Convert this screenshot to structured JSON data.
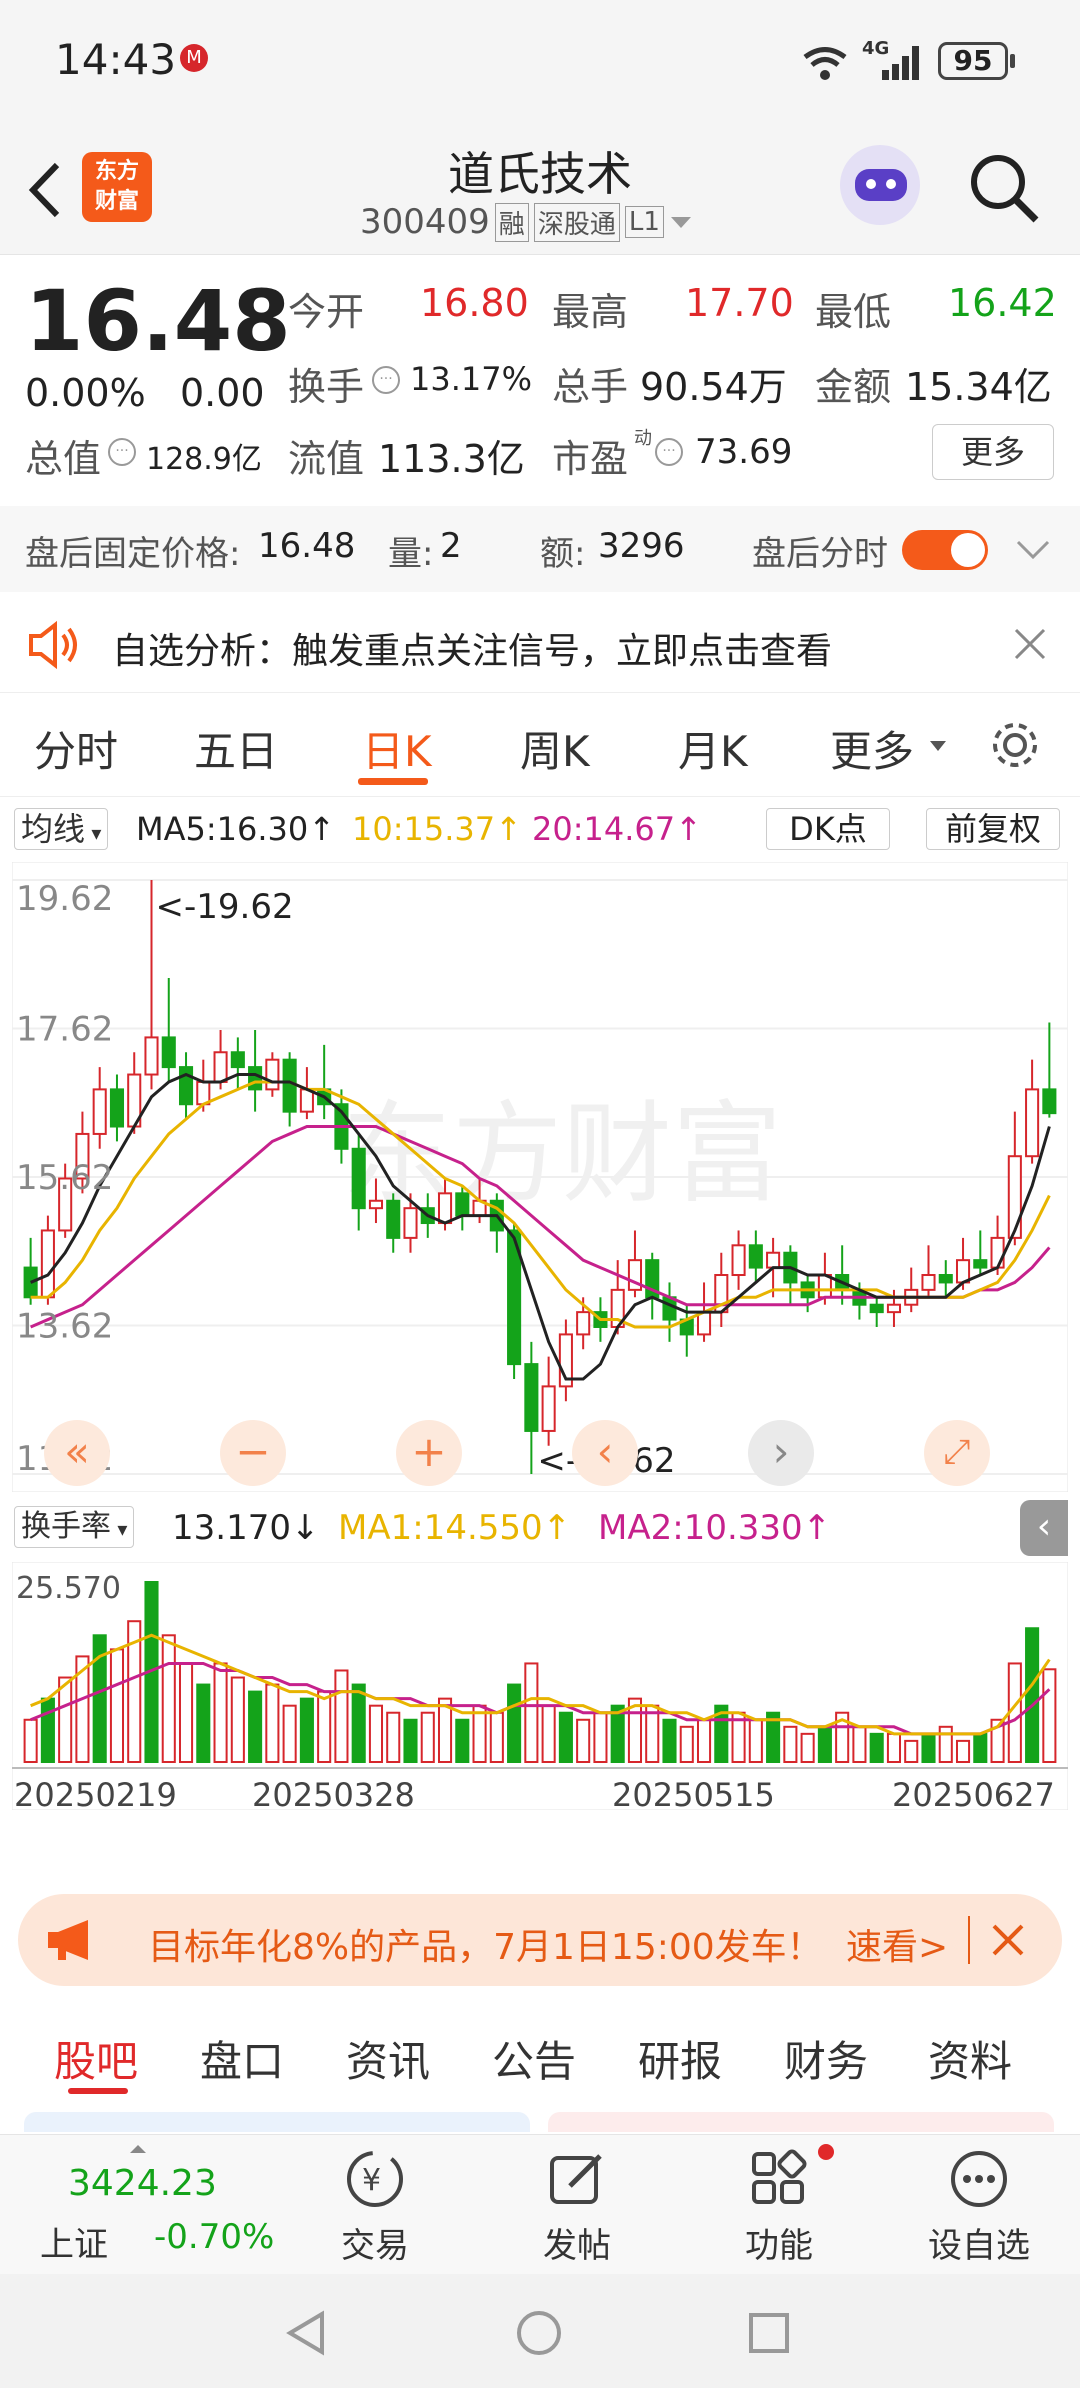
{
  "status": {
    "time": "14:43",
    "network": "4G",
    "battery": "95"
  },
  "header": {
    "back": "<",
    "logo_line1": "东方",
    "logo_line2": "财富",
    "title": "道氏技术",
    "code": "300409",
    "badges": [
      "融",
      "深股通",
      "L1"
    ]
  },
  "quote": {
    "price": "16.48",
    "change_pct": "0.00%",
    "change": "0.00",
    "open_label": "今开",
    "open": "16.80",
    "high_label": "最高",
    "high": "17.70",
    "low_label": "最低",
    "low": "16.42",
    "turnover_label": "换手",
    "turnover": "13.17%",
    "volume_label": "总手",
    "volume": "90.54万",
    "amount_label": "金额",
    "amount": "15.34亿",
    "mktcap_label": "总值",
    "mktcap": "128.9亿",
    "float_label": "流值",
    "float": "113.3亿",
    "pe_label": "市盈",
    "pe_sup": "动",
    "pe": "73.69",
    "more": "更多"
  },
  "afterhours": {
    "price_label": "盘后固定价格:",
    "price": "16.48",
    "vol_label": "量:",
    "vol": "2",
    "amt_label": "额:",
    "amt": "3296",
    "toggle_label": "盘后分时"
  },
  "notice": {
    "text": "自选分析：触发重点关注信号，立即点击查看"
  },
  "tabs": [
    "分时",
    "五日",
    "日K",
    "周K",
    "月K",
    "更多",
    "settings"
  ],
  "ma_bar": {
    "selector": "均线",
    "ma5": "MA5:16.30↑",
    "ma10": "10:15.37↑",
    "ma20": "20:14.67↑",
    "dk": "DK点",
    "adjust": "前复权"
  },
  "chart_data": {
    "type": "candlestick",
    "y_ticks": [
      "19.62",
      "17.62",
      "15.62",
      "13.62",
      "11.62"
    ],
    "max_label": "<-19.62",
    "min_label": "<-11.62",
    "watermark": "东方财富",
    "ylim": [
      11.62,
      19.62
    ],
    "candles": [
      [
        14.4,
        14.0,
        14.8,
        13.9
      ],
      [
        14.0,
        14.9,
        15.1,
        13.9
      ],
      [
        14.9,
        15.6,
        15.8,
        14.8
      ],
      [
        15.6,
        16.2,
        16.5,
        15.4
      ],
      [
        16.2,
        16.8,
        17.1,
        16.0
      ],
      [
        16.8,
        16.3,
        17.0,
        16.1
      ],
      [
        16.3,
        17.0,
        17.3,
        16.2
      ],
      [
        17.0,
        17.5,
        19.62,
        16.8
      ],
      [
        17.5,
        17.1,
        18.3,
        16.9
      ],
      [
        17.1,
        16.6,
        17.3,
        16.4
      ],
      [
        16.6,
        16.9,
        17.2,
        16.5
      ],
      [
        16.9,
        17.3,
        17.6,
        16.8
      ],
      [
        17.3,
        17.1,
        17.5,
        16.8
      ],
      [
        17.1,
        16.8,
        17.6,
        16.5
      ],
      [
        16.8,
        17.2,
        17.3,
        16.7
      ],
      [
        17.2,
        16.5,
        17.3,
        16.3
      ],
      [
        16.5,
        16.8,
        17.1,
        16.4
      ],
      [
        16.8,
        16.6,
        17.4,
        16.4
      ],
      [
        16.6,
        16.0,
        16.8,
        15.8
      ],
      [
        16.0,
        15.2,
        16.2,
        14.9
      ],
      [
        15.2,
        15.3,
        15.6,
        15.0
      ],
      [
        15.3,
        14.8,
        15.4,
        14.6
      ],
      [
        14.8,
        15.2,
        15.4,
        14.6
      ],
      [
        15.2,
        15.0,
        15.4,
        14.8
      ],
      [
        15.0,
        15.4,
        15.6,
        14.9
      ],
      [
        15.4,
        15.1,
        15.5,
        14.9
      ],
      [
        15.1,
        15.3,
        15.6,
        15.0
      ],
      [
        15.3,
        14.9,
        15.4,
        14.6
      ],
      [
        14.9,
        13.1,
        15.0,
        12.9
      ],
      [
        13.1,
        12.2,
        13.4,
        11.62
      ],
      [
        12.2,
        12.8,
        13.2,
        12.0
      ],
      [
        12.8,
        13.5,
        13.7,
        12.6
      ],
      [
        13.5,
        13.8,
        14.0,
        13.3
      ],
      [
        13.8,
        13.6,
        14.0,
        13.4
      ],
      [
        13.6,
        14.1,
        14.5,
        13.5
      ],
      [
        14.1,
        14.5,
        14.9,
        14.0
      ],
      [
        14.5,
        14.0,
        14.6,
        13.7
      ],
      [
        14.0,
        13.7,
        14.2,
        13.4
      ],
      [
        13.7,
        13.5,
        13.9,
        13.2
      ],
      [
        13.5,
        13.8,
        14.2,
        13.4
      ],
      [
        13.8,
        14.3,
        14.6,
        13.6
      ],
      [
        14.3,
        14.7,
        14.9,
        14.1
      ],
      [
        14.7,
        14.4,
        14.9,
        14.2
      ],
      [
        14.4,
        14.6,
        14.8,
        14.0
      ],
      [
        14.6,
        14.2,
        14.7,
        13.9
      ],
      [
        14.2,
        14.0,
        14.3,
        13.8
      ],
      [
        14.0,
        14.3,
        14.6,
        13.9
      ],
      [
        14.3,
        14.1,
        14.7,
        13.9
      ],
      [
        14.1,
        13.9,
        14.2,
        13.7
      ],
      [
        13.9,
        13.8,
        14.0,
        13.6
      ],
      [
        13.8,
        13.9,
        14.1,
        13.6
      ],
      [
        13.9,
        14.1,
        14.4,
        13.8
      ],
      [
        14.1,
        14.3,
        14.7,
        14.0
      ],
      [
        14.3,
        14.2,
        14.5,
        14.0
      ],
      [
        14.2,
        14.5,
        14.8,
        14.1
      ],
      [
        14.5,
        14.4,
        14.9,
        14.3
      ],
      [
        14.4,
        14.8,
        15.1,
        14.3
      ],
      [
        14.8,
        15.9,
        16.5,
        14.7
      ],
      [
        15.9,
        16.8,
        17.2,
        15.8
      ],
      [
        16.8,
        16.48,
        17.7,
        16.42
      ]
    ],
    "ma5": [
      14.2,
      14.3,
      14.6,
      15.0,
      15.5,
      15.9,
      16.3,
      16.7,
      16.9,
      17.0,
      16.9,
      16.9,
      17.0,
      17.0,
      16.9,
      16.9,
      16.8,
      16.7,
      16.5,
      16.2,
      15.9,
      15.5,
      15.3,
      15.1,
      15.0,
      15.1,
      15.1,
      15.1,
      14.8,
      14.1,
      13.4,
      12.9,
      12.9,
      13.1,
      13.6,
      13.9,
      14.0,
      13.9,
      13.8,
      13.8,
      13.8,
      14.0,
      14.2,
      14.4,
      14.4,
      14.3,
      14.3,
      14.2,
      14.1,
      14.0,
      14.0,
      14.0,
      14.0,
      14.0,
      14.2,
      14.3,
      14.4,
      14.9,
      15.5,
      16.3
    ],
    "ma10": [
      14.0,
      14.0,
      14.2,
      14.5,
      14.9,
      15.2,
      15.6,
      15.9,
      16.2,
      16.4,
      16.6,
      16.7,
      16.8,
      16.9,
      16.9,
      16.9,
      16.8,
      16.8,
      16.7,
      16.6,
      16.4,
      16.2,
      16.0,
      15.8,
      15.6,
      15.5,
      15.3,
      15.2,
      15.0,
      14.7,
      14.4,
      14.1,
      13.9,
      13.7,
      13.7,
      13.6,
      13.6,
      13.6,
      13.7,
      13.8,
      13.9,
      14.0,
      14.0,
      14.1,
      14.1,
      14.1,
      14.1,
      14.1,
      14.1,
      14.1,
      14.0,
      14.0,
      14.0,
      14.0,
      14.0,
      14.1,
      14.2,
      14.5,
      14.9,
      15.37
    ],
    "ma20": [
      13.6,
      13.7,
      13.8,
      13.9,
      14.1,
      14.3,
      14.5,
      14.7,
      14.9,
      15.1,
      15.3,
      15.5,
      15.7,
      15.9,
      16.1,
      16.2,
      16.3,
      16.3,
      16.3,
      16.3,
      16.3,
      16.2,
      16.1,
      16.0,
      15.9,
      15.8,
      15.6,
      15.5,
      15.3,
      15.1,
      14.9,
      14.7,
      14.5,
      14.4,
      14.3,
      14.2,
      14.1,
      14.0,
      13.9,
      13.9,
      13.9,
      13.9,
      13.9,
      13.9,
      13.9,
      13.9,
      14.0,
      14.0,
      14.0,
      14.0,
      14.0,
      14.0,
      14.0,
      14.0,
      14.0,
      14.1,
      14.1,
      14.2,
      14.4,
      14.67
    ]
  },
  "turnover_bar": {
    "selector": "换手率",
    "value": "13.170↓",
    "ma1": "MA1:14.550↑",
    "ma2": "MA2:10.330↑"
  },
  "turnover_chart": {
    "max_label": "25.570",
    "ylim": [
      0,
      25.57
    ],
    "x_labels": [
      "20250219",
      "20250328",
      "20250515",
      "20250627"
    ],
    "values": [
      6,
      9,
      12,
      15,
      18,
      16,
      20,
      25.57,
      18,
      14,
      11,
      14,
      12,
      10,
      11,
      8,
      9,
      10,
      13,
      11,
      8,
      7,
      6,
      7,
      9,
      6,
      8,
      7,
      11,
      14,
      8,
      7,
      6,
      7,
      8,
      9,
      8,
      6,
      5,
      6,
      8,
      7,
      6,
      7,
      5,
      4,
      5,
      7,
      5,
      4,
      4,
      3,
      4,
      5,
      3,
      4,
      6,
      14,
      19,
      13.17
    ],
    "ma1": [
      8,
      9,
      11,
      13,
      15,
      16,
      17,
      18,
      17,
      16,
      15,
      14,
      13,
      12,
      11,
      10,
      10,
      9,
      10,
      10,
      9,
      9,
      8,
      8,
      8,
      7,
      7,
      7,
      8,
      9,
      9,
      8,
      8,
      7,
      7,
      8,
      8,
      7,
      7,
      6,
      7,
      7,
      6,
      6,
      6,
      5,
      5,
      6,
      5,
      5,
      4,
      4,
      4,
      4,
      4,
      4,
      5,
      8,
      11,
      14.55
    ],
    "ma2": [
      6,
      7,
      8,
      9,
      10,
      11,
      12,
      13,
      14,
      14,
      14,
      13,
      13,
      12,
      12,
      11,
      11,
      10,
      10,
      10,
      9,
      9,
      9,
      8,
      8,
      8,
      8,
      7,
      8,
      8,
      8,
      8,
      7,
      7,
      7,
      7,
      7,
      7,
      6,
      6,
      6,
      6,
      6,
      6,
      6,
      5,
      5,
      5,
      5,
      5,
      5,
      4,
      4,
      4,
      4,
      4,
      5,
      6,
      8,
      10.33
    ]
  },
  "promo": {
    "text": "目标年化8%的产品，7月1日15:00发车！",
    "link": "速看>"
  },
  "bottom_tabs": [
    "股吧",
    "盘口",
    "资讯",
    "公告",
    "研报",
    "财务",
    "资料"
  ],
  "nav": {
    "index_value": "3424.23",
    "index_name": "上证",
    "index_change": "-0.70%",
    "items": [
      "交易",
      "发帖",
      "功能",
      "设自选"
    ]
  }
}
